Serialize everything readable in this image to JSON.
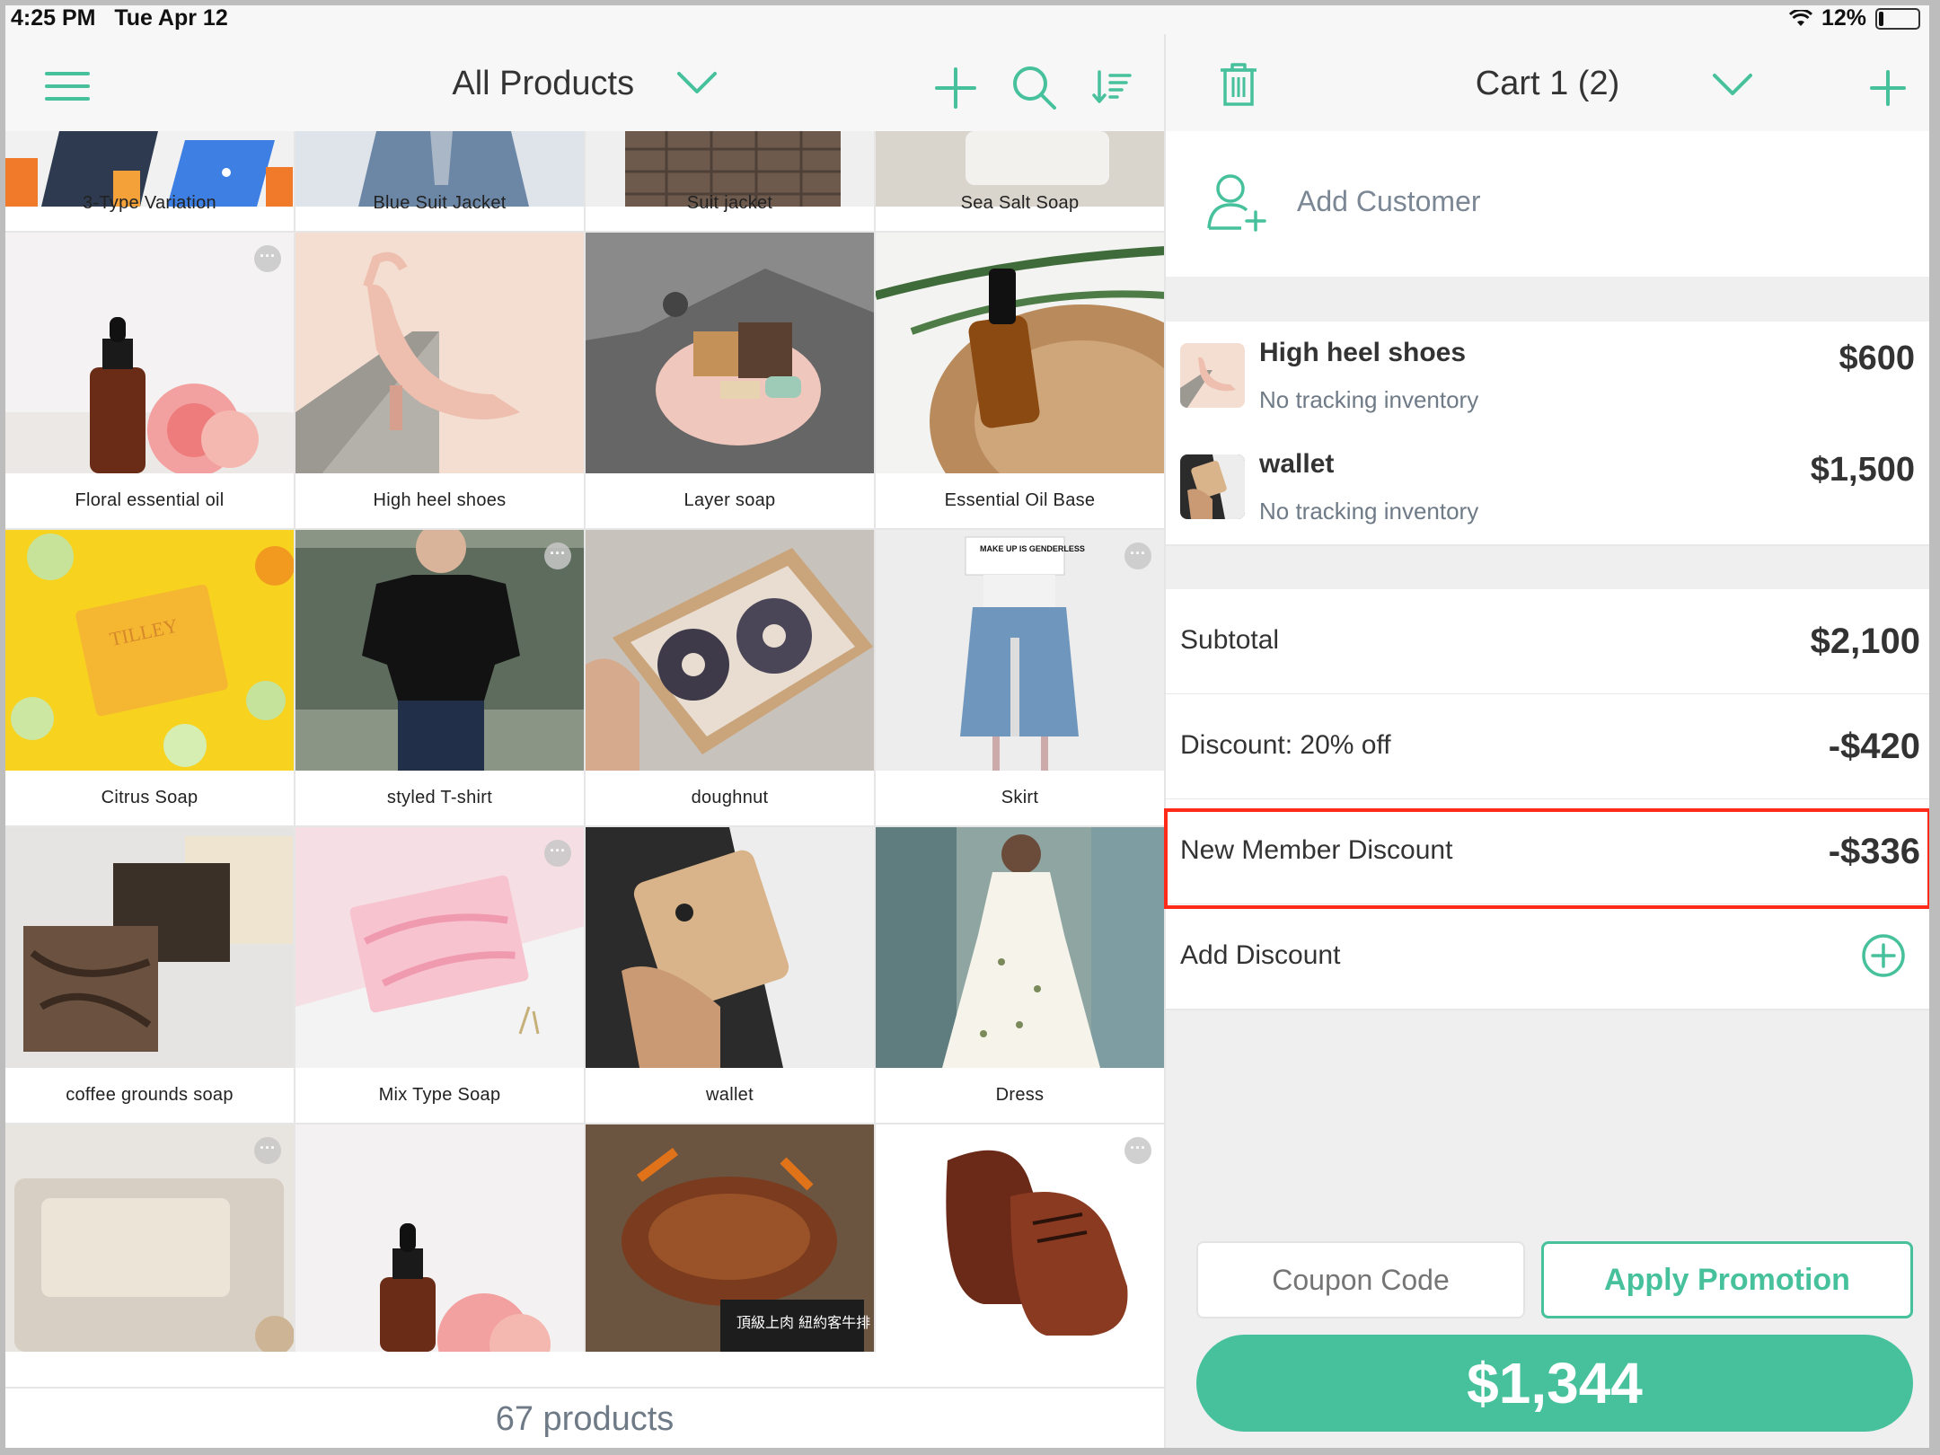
{
  "status_bar": {
    "time": "4:25 PM",
    "date": "Tue Apr 12",
    "battery": "12%"
  },
  "products_header": {
    "title": "All Products"
  },
  "cart_header": {
    "title": "Cart 1 (2)"
  },
  "products": [
    {
      "name": "3-Type Variation"
    },
    {
      "name": "Blue Suit Jacket"
    },
    {
      "name": "Suit jacket"
    },
    {
      "name": "Sea Salt Soap"
    },
    {
      "name": "Floral essential oil"
    },
    {
      "name": "High heel shoes"
    },
    {
      "name": "Layer soap"
    },
    {
      "name": "Essential Oil Base"
    },
    {
      "name": "Citrus Soap"
    },
    {
      "name": "styled T-shirt"
    },
    {
      "name": "doughnut"
    },
    {
      "name": "Skirt"
    },
    {
      "name": "coffee grounds soap"
    },
    {
      "name": "Mix Type Soap"
    },
    {
      "name": "wallet"
    },
    {
      "name": "Dress"
    }
  ],
  "products_footer": "67 products",
  "customer": {
    "label": "Add Customer"
  },
  "cart_items": [
    {
      "name": "High heel shoes",
      "inventory": "No tracking inventory",
      "price": "$600"
    },
    {
      "name": "wallet",
      "inventory": "No tracking inventory",
      "price": "$1,500"
    }
  ],
  "summary": {
    "subtotal_label": "Subtotal",
    "subtotal": "$2,100",
    "discount_label": "Discount: 20% off",
    "discount": "-$420",
    "member_label": "New Member Discount",
    "member": "-$336",
    "add_discount_label": "Add Discount"
  },
  "coupon_placeholder": "Coupon Code",
  "apply_label": "Apply Promotion",
  "total": "$1,344",
  "colors": {
    "accent": "#46c19c",
    "highlight": "#ff2a1a"
  },
  "image_text": {
    "steak": "頂級上肉 紐約客牛排",
    "soap": "TILLEY",
    "sign": "MAKE UP IS GENDERLESS"
  }
}
